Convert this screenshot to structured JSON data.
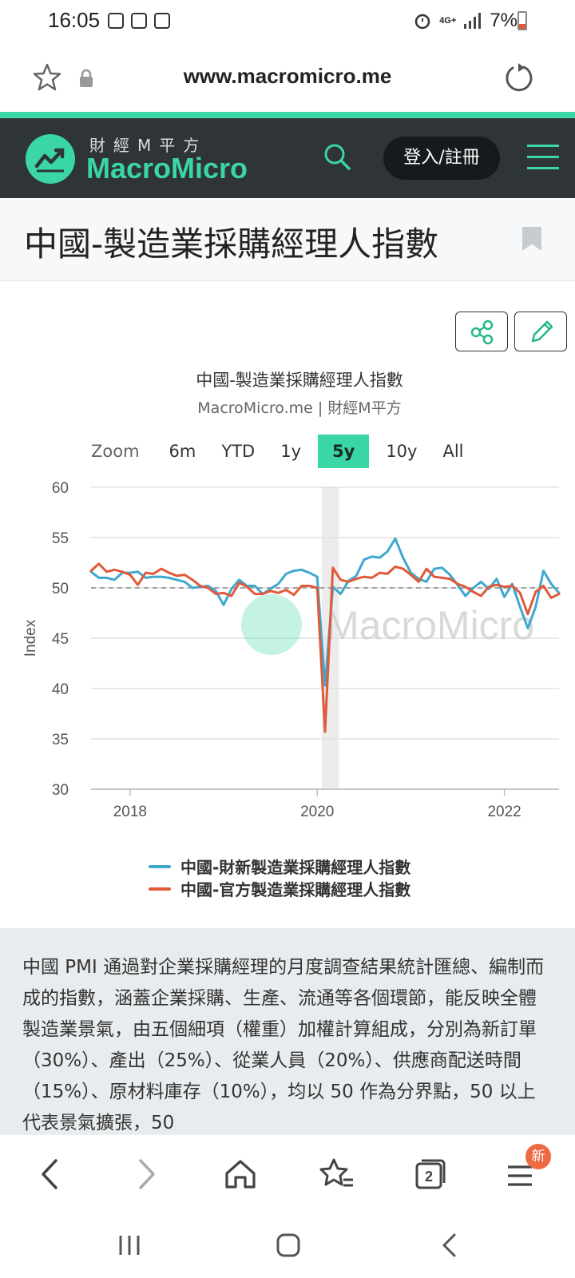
{
  "status_bar": {
    "time": "16:05",
    "network": "4G+",
    "battery": "7%"
  },
  "browser": {
    "url": "www.macromicro.me"
  },
  "site": {
    "logo_zh": "財經M平方",
    "logo_en": "MacroMicro",
    "login_label": "登入/註冊"
  },
  "page": {
    "title": "中國-製造業採購經理人指數"
  },
  "chart_header": {
    "title": "中國-製造業採購經理人指數",
    "subtitle": "MacroMicro.me | 財經M平方"
  },
  "zoom": {
    "label": "Zoom",
    "options": [
      "6m",
      "YTD",
      "1y",
      "5y",
      "10y",
      "All"
    ],
    "selected": "5y"
  },
  "chart_data": {
    "type": "line",
    "ylabel": "Index",
    "ylim": [
      30,
      60
    ],
    "yticks": [
      60,
      55,
      50,
      45,
      40,
      35,
      30
    ],
    "xticks": [
      "2018",
      "2020",
      "2022"
    ],
    "reference_line": 50,
    "shaded_period": [
      "2020-02",
      "2020-04"
    ],
    "watermark": "MacroMicro",
    "series": [
      {
        "name": "中國-財新製造業採購經理人指數",
        "color": "#3fa8cf",
        "points": [
          [
            "2017-08",
            51.6
          ],
          [
            "2017-09",
            51.0
          ],
          [
            "2017-10",
            51.0
          ],
          [
            "2017-11",
            50.8
          ],
          [
            "2017-12",
            51.5
          ],
          [
            "2018-01",
            51.5
          ],
          [
            "2018-02",
            51.6
          ],
          [
            "2018-03",
            51.0
          ],
          [
            "2018-04",
            51.1
          ],
          [
            "2018-05",
            51.1
          ],
          [
            "2018-06",
            51.0
          ],
          [
            "2018-07",
            50.8
          ],
          [
            "2018-08",
            50.6
          ],
          [
            "2018-09",
            50.0
          ],
          [
            "2018-10",
            50.1
          ],
          [
            "2018-11",
            50.2
          ],
          [
            "2018-12",
            49.7
          ],
          [
            "2019-01",
            48.3
          ],
          [
            "2019-02",
            49.9
          ],
          [
            "2019-03",
            50.8
          ],
          [
            "2019-04",
            50.2
          ],
          [
            "2019-05",
            50.2
          ],
          [
            "2019-06",
            49.4
          ],
          [
            "2019-07",
            49.9
          ],
          [
            "2019-08",
            50.4
          ],
          [
            "2019-09",
            51.4
          ],
          [
            "2019-10",
            51.7
          ],
          [
            "2019-11",
            51.8
          ],
          [
            "2019-12",
            51.5
          ],
          [
            "2020-01",
            51.1
          ],
          [
            "2020-02",
            40.3
          ],
          [
            "2020-03",
            50.1
          ],
          [
            "2020-04",
            49.4
          ],
          [
            "2020-05",
            50.7
          ],
          [
            "2020-06",
            51.2
          ],
          [
            "2020-07",
            52.8
          ],
          [
            "2020-08",
            53.1
          ],
          [
            "2020-09",
            53.0
          ],
          [
            "2020-10",
            53.6
          ],
          [
            "2020-11",
            54.9
          ],
          [
            "2020-12",
            53.0
          ],
          [
            "2021-01",
            51.5
          ],
          [
            "2021-02",
            50.9
          ],
          [
            "2021-03",
            50.6
          ],
          [
            "2021-04",
            51.9
          ],
          [
            "2021-05",
            52.0
          ],
          [
            "2021-06",
            51.3
          ],
          [
            "2021-07",
            50.3
          ],
          [
            "2021-08",
            49.2
          ],
          [
            "2021-09",
            50.0
          ],
          [
            "2021-10",
            50.6
          ],
          [
            "2021-11",
            49.9
          ],
          [
            "2021-12",
            50.9
          ],
          [
            "2022-01",
            49.1
          ],
          [
            "2022-02",
            50.4
          ],
          [
            "2022-03",
            48.1
          ],
          [
            "2022-04",
            46.0
          ],
          [
            "2022-05",
            48.1
          ],
          [
            "2022-06",
            51.7
          ],
          [
            "2022-07",
            50.4
          ],
          [
            "2022-08",
            49.5
          ]
        ]
      },
      {
        "name": "中國-官方製造業採購經理人指數",
        "color": "#e05a3a",
        "points": [
          [
            "2017-08",
            51.7
          ],
          [
            "2017-09",
            52.4
          ],
          [
            "2017-10",
            51.6
          ],
          [
            "2017-11",
            51.8
          ],
          [
            "2017-12",
            51.6
          ],
          [
            "2018-01",
            51.3
          ],
          [
            "2018-02",
            50.3
          ],
          [
            "2018-03",
            51.5
          ],
          [
            "2018-04",
            51.4
          ],
          [
            "2018-05",
            51.9
          ],
          [
            "2018-06",
            51.5
          ],
          [
            "2018-07",
            51.2
          ],
          [
            "2018-08",
            51.3
          ],
          [
            "2018-09",
            50.8
          ],
          [
            "2018-10",
            50.2
          ],
          [
            "2018-11",
            50.0
          ],
          [
            "2018-12",
            49.4
          ],
          [
            "2019-01",
            49.5
          ],
          [
            "2019-02",
            49.2
          ],
          [
            "2019-03",
            50.5
          ],
          [
            "2019-04",
            50.1
          ],
          [
            "2019-05",
            49.4
          ],
          [
            "2019-06",
            49.4
          ],
          [
            "2019-07",
            49.7
          ],
          [
            "2019-08",
            49.5
          ],
          [
            "2019-09",
            49.8
          ],
          [
            "2019-10",
            49.3
          ],
          [
            "2019-11",
            50.2
          ],
          [
            "2019-12",
            50.2
          ],
          [
            "2020-01",
            50.0
          ],
          [
            "2020-02",
            35.7
          ],
          [
            "2020-03",
            52.0
          ],
          [
            "2020-04",
            50.8
          ],
          [
            "2020-05",
            50.6
          ],
          [
            "2020-06",
            50.9
          ],
          [
            "2020-07",
            51.1
          ],
          [
            "2020-08",
            51.0
          ],
          [
            "2020-09",
            51.5
          ],
          [
            "2020-10",
            51.4
          ],
          [
            "2020-11",
            52.1
          ],
          [
            "2020-12",
            51.9
          ],
          [
            "2021-01",
            51.3
          ],
          [
            "2021-02",
            50.6
          ],
          [
            "2021-03",
            51.9
          ],
          [
            "2021-04",
            51.1
          ],
          [
            "2021-05",
            51.0
          ],
          [
            "2021-06",
            50.9
          ],
          [
            "2021-07",
            50.4
          ],
          [
            "2021-08",
            50.1
          ],
          [
            "2021-09",
            49.6
          ],
          [
            "2021-10",
            49.2
          ],
          [
            "2021-11",
            50.1
          ],
          [
            "2021-12",
            50.3
          ],
          [
            "2022-01",
            50.1
          ],
          [
            "2022-02",
            50.2
          ],
          [
            "2022-03",
            49.5
          ],
          [
            "2022-04",
            47.4
          ],
          [
            "2022-05",
            49.6
          ],
          [
            "2022-06",
            50.2
          ],
          [
            "2022-07",
            49.0
          ],
          [
            "2022-08",
            49.4
          ]
        ]
      }
    ]
  },
  "description": {
    "text": "中國 PMI 通過對企業採購經理的月度調查結果統計匯總、編制而成的指數，涵蓋企業採購、生產、流通等各個環節，能反映全體製造業景氣，由五個細項（權重）加權計算組成，分別為新訂單（30%）、產出（25%）、從業人員（20%）、供應商配送時間（15%）、原材料庫存（10%），均以 50 作為分界點，50 以上代表景氣擴張，50"
  },
  "bottom_nav": {
    "tabs_count": "2",
    "menu_badge": "新"
  }
}
